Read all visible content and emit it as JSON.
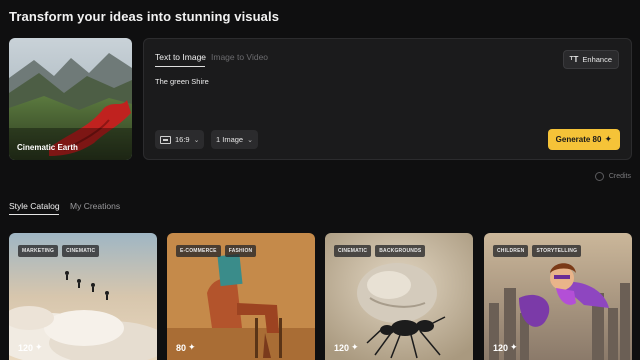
{
  "page": {
    "title": "Transform your ideas into stunning visuals"
  },
  "preset": {
    "label": "Cinematic Earth"
  },
  "prompt_panel": {
    "tabs": [
      {
        "label": "Text to Image",
        "active": true
      },
      {
        "label": "Image to Video",
        "active": false
      }
    ],
    "enhance_label": "Enhance",
    "prompt_value": "The green Shire",
    "aspect_ratio": "16:9",
    "image_count": "1 Image",
    "generate_label": "Generate 80",
    "spark_glyph": "✦"
  },
  "credits_label": "Credits",
  "catalog_tabs": [
    {
      "label": "Style Catalog",
      "active": true
    },
    {
      "label": "My Creations",
      "active": false
    }
  ],
  "styles": [
    {
      "tags": [
        "MARKETING",
        "CINEMATIC"
      ],
      "price": "120"
    },
    {
      "tags": [
        "E-COMMERCE",
        "FASHION"
      ],
      "price": "80"
    },
    {
      "tags": [
        "CINEMATIC",
        "BACKGROUNDS"
      ],
      "price": "120"
    },
    {
      "tags": [
        "CHILDREN",
        "STORYTELLING"
      ],
      "price": "120"
    }
  ],
  "colors": {
    "accent": "#f5c338",
    "background": "#0f0f10",
    "panel": "#1b1b1c"
  }
}
